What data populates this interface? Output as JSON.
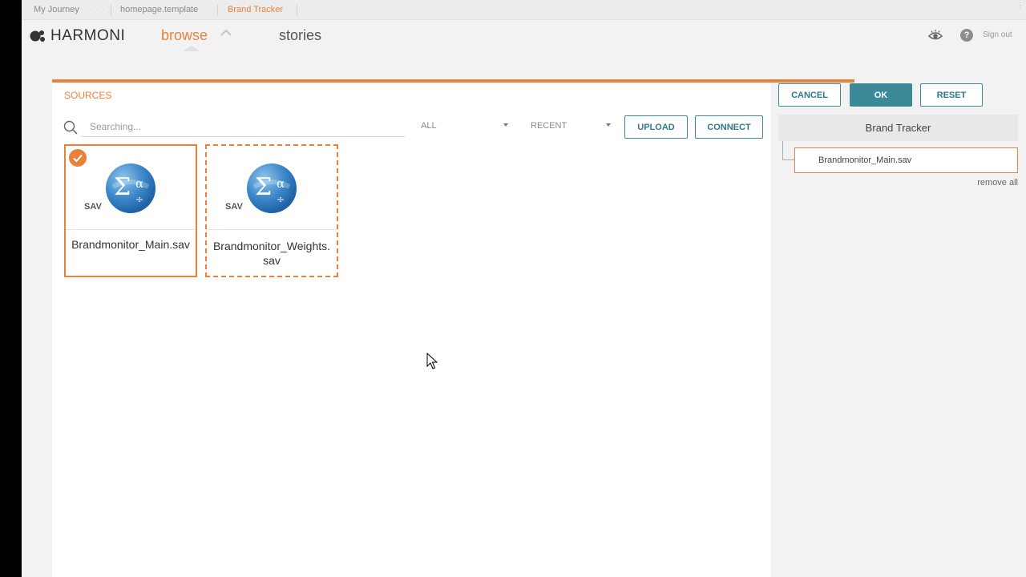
{
  "breadcrumbs": [
    {
      "label": "My Journey"
    },
    {
      "label": "homepage.template"
    },
    {
      "label": "Brand Tracker"
    }
  ],
  "header": {
    "brand": "HARMONI",
    "nav": {
      "browse": "browse",
      "stories": "stories"
    },
    "sign_out": "Sign out",
    "help": "?"
  },
  "sources": {
    "title": "SOURCES",
    "search_placeholder": "Searching...",
    "filter_type": "ALL",
    "filter_sort": "RECENT",
    "upload_label": "UPLOAD",
    "connect_label": "CONNECT",
    "files": [
      {
        "name": "Brandmonitor_Main.sav",
        "badge": "SAV",
        "selected": true
      },
      {
        "name": "Brandmonitor_Weights.sav",
        "badge": "SAV",
        "selected": false
      }
    ]
  },
  "panel": {
    "cancel_label": "CANCEL",
    "ok_label": "OK",
    "reset_label": "RESET",
    "title": "Brand Tracker",
    "items": [
      {
        "name": "Brandmonitor_Main.sav"
      }
    ],
    "remove_all": "remove all"
  },
  "colors": {
    "accent": "#e8823a",
    "teal": "#3c8a99"
  }
}
